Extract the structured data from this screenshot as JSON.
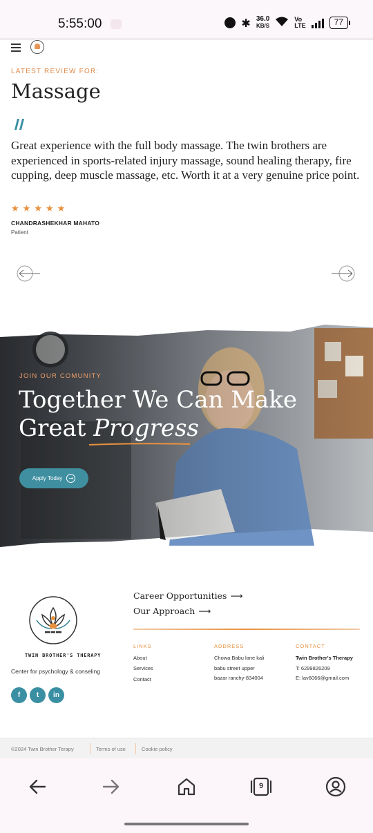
{
  "status_bar": {
    "time": "5:55:00",
    "net_speed_value": "36.0",
    "net_speed_unit": "KB/S",
    "volte_top": "Vo",
    "volte_bottom": "LTE",
    "battery": "77",
    "icons": [
      "recording-icon",
      "alarm-icon",
      "bluetooth-icon",
      "wifi-icon",
      "signal-icon",
      "battery-icon"
    ]
  },
  "header": {
    "menu_icon": "hamburger-icon",
    "logo_icon": "lotus-logo-icon"
  },
  "review": {
    "eyebrow": "LATEST REVIEW FOR:",
    "title": "Massage",
    "text": "Great experience with the full body massage. The twin brothers are experienced in sports-related injury massage, sound healing therapy, fire cupping, deep muscle massage, etc. Worth it at a very genuine price point.",
    "stars": [
      "★",
      "★",
      "★",
      "★",
      "★"
    ],
    "rating": 5,
    "reviewer_name": "CHANDRASHEKHAR MAHATO",
    "reviewer_role": "Patient"
  },
  "hero": {
    "eyebrow": "JOIN OUR COMUNITY",
    "title_line1": "Together We Can Make",
    "title_line2_plain": "Great ",
    "title_line2_em": "Progress",
    "apply_label": "Apply Today"
  },
  "footer": {
    "brand_name": "TWIN BROTHER'S THERAPY",
    "brand_tagline": "Center for psychology & conseling",
    "socials": [
      "f",
      "t",
      "in"
    ],
    "top_links": [
      "Career Opportunities",
      "Our Approach"
    ],
    "links_heading": "LINKS",
    "links": [
      "About",
      "Services",
      "Contact"
    ],
    "address_heading": "ADDRESS",
    "address_lines": [
      "Chowa Babu lane kali",
      "babu street upper",
      "bazar ranchy-834004"
    ],
    "contact_heading": "CONTACT",
    "contact_name": "Twin Brother's Therapy",
    "contact_phone": "T: 6299826209",
    "contact_email": "E: lav6066@gmail.com",
    "copyright": "©2024 Twin Brother Terapy",
    "terms": "Terms of use",
    "cookie": "Cookie policy"
  },
  "browser_nav": {
    "tab_count": "9",
    "icons": [
      "back-arrow-icon",
      "forward-arrow-icon",
      "home-icon",
      "tabs-icon",
      "account-icon"
    ]
  },
  "colors": {
    "accent_orange": "#e8913f",
    "teal": "#3f8fa0",
    "text_dark": "#222222"
  }
}
